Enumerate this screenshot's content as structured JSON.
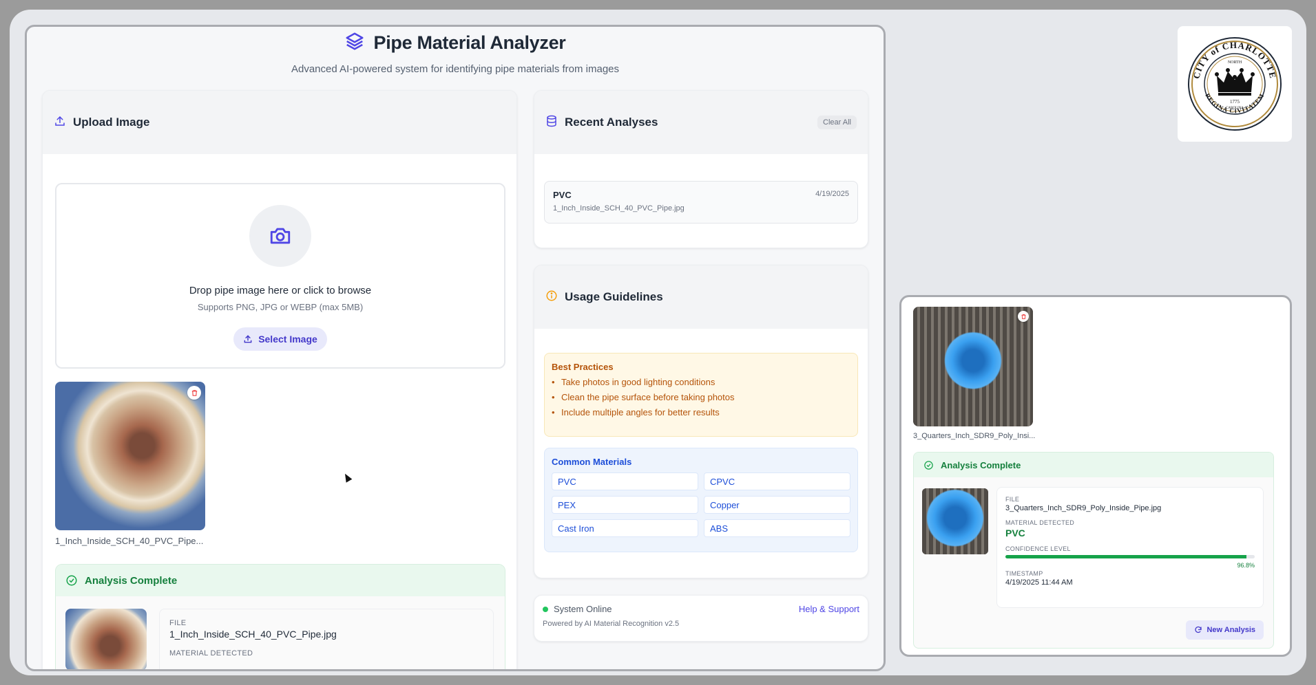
{
  "app": {
    "title": "Pipe Material Analyzer",
    "subtitle": "Advanced AI-powered system for identifying pipe materials from images"
  },
  "upload": {
    "heading": "Upload Image",
    "drop_title": "Drop pipe image here or click to browse",
    "drop_sub": "Supports PNG, JPG or WEBP (max 5MB)",
    "select_label": "Select Image",
    "thumbnail_name": "1_Inch_Inside_SCH_40_PVC_Pipe...",
    "result": {
      "status": "Analysis Complete",
      "file_label": "FILE",
      "file_value": "1_Inch_Inside_SCH_40_PVC_Pipe.jpg",
      "material_label": "MATERIAL DETECTED"
    }
  },
  "recent": {
    "heading": "Recent Analyses",
    "clear_label": "Clear All",
    "items": [
      {
        "material": "PVC",
        "file": "1_Inch_Inside_SCH_40_PVC_Pipe.jpg",
        "date": "4/19/2025"
      }
    ]
  },
  "usage": {
    "heading": "Usage Guidelines",
    "best_title": "Best Practices",
    "best_items": [
      "Take photos in good lighting conditions",
      "Clean the pipe surface before taking photos",
      "Include multiple angles for better results"
    ],
    "common_title": "Common Materials",
    "materials": [
      "PVC",
      "CPVC",
      "PEX",
      "Copper",
      "Cast Iron",
      "ABS"
    ]
  },
  "status": {
    "online": "System Online",
    "help": "Help & Support",
    "powered": "Powered by AI Material Recognition v2.5"
  },
  "side": {
    "thumbnail_name": "3_Quarters_Inch_SDR9_Poly_Insi...",
    "status": "Analysis Complete",
    "file_label": "FILE",
    "file_value": "3_Quarters_Inch_SDR9_Poly_Inside_Pipe.jpg",
    "material_label": "MATERIAL DETECTED",
    "material_value": "PVC",
    "confidence_label": "CONFIDENCE LEVEL",
    "confidence_value": "96.8%",
    "confidence_fraction": 0.968,
    "timestamp_label": "TIMESTAMP",
    "timestamp_value": "4/19/2025 11:44 AM",
    "new_label": "New Analysis"
  },
  "logo": {
    "top_text": "CITY of CHARLOTTE",
    "north": "NORTH",
    "year": "1775",
    "carolina": "CAROLINA",
    "bottom_text": "REGINA CIVITATEM"
  },
  "colors": {
    "accent": "#4f46e5",
    "success": "#16a34a",
    "warning": "#b45309",
    "info": "#1d4ed8"
  }
}
